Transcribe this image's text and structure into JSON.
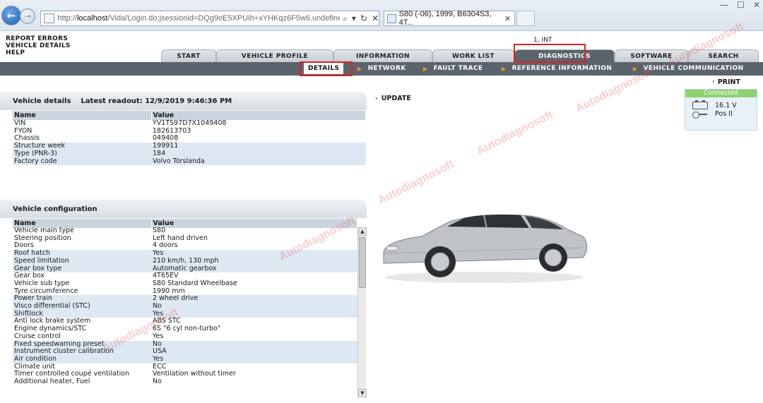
{
  "browser": {
    "url_prefix": "http://",
    "url_host": "localhost",
    "url_rest": "/Vida/Login.do;jsessionid=DQg9oE5XPUih+xYHKqz6F5w6.undefined",
    "address_tools": [
      "⌕",
      "▾",
      "↻",
      "✕"
    ],
    "tab_title": "S80 (-06), 1999, B6304S3, 4T...",
    "tab_close": "✕",
    "window_controls": [
      "—",
      "☐",
      "✕"
    ]
  },
  "toplinks": [
    "REPORT ERRORS",
    "VEHICLE DETAILS",
    "HELP"
  ],
  "user_code": "1, INT",
  "tabs": [
    {
      "label": "START"
    },
    {
      "label": "VEHICLE PROFILE"
    },
    {
      "label": "INFORMATION"
    },
    {
      "label": "WORK LIST"
    },
    {
      "label": "DIAGNOSTICS"
    },
    {
      "label": "SOFTWARE"
    },
    {
      "label": "SEARCH"
    }
  ],
  "subtabs": [
    {
      "label": "DETAILS"
    },
    {
      "label": "NETWORK"
    },
    {
      "label": "FAULT TRACE"
    },
    {
      "label": "REFERENCE INFORMATION"
    },
    {
      "label": "VEHICLE COMMUNICATION"
    }
  ],
  "vehicle_details": {
    "title": "Vehicle details",
    "readout": "Latest readout: 12/9/2019 9:46:36 PM",
    "col_name": "Name",
    "col_value": "Value",
    "rows": [
      [
        "VIN",
        "YV1TS97D7X1049408"
      ],
      [
        "FYON",
        "182613703"
      ],
      [
        "Chassis",
        "049408"
      ],
      [
        "Structure week",
        "199911"
      ],
      [
        "Type (PNR-3)",
        "184"
      ],
      [
        "Factory code",
        "Volvo Torslanda"
      ]
    ]
  },
  "vehicle_config": {
    "title": "Vehicle configuration",
    "col_name": "Name",
    "col_value": "Value",
    "rows": [
      [
        "Vehicle main type",
        "S80"
      ],
      [
        "Steering position",
        "Left hand driven"
      ],
      [
        "Doors",
        "4 doors"
      ],
      [
        "Roof hatch",
        "Yes"
      ],
      [
        "Speed limitation",
        "210 km/h, 130 mph"
      ],
      [
        "Gear box type",
        "Automatic gearbox"
      ],
      [
        "Gear box",
        "4T65EV"
      ],
      [
        "Vehicle sub type",
        "S80 Standard Wheelbase"
      ],
      [
        "Tyre circumference",
        "1990 mm"
      ],
      [
        "Power train",
        "2 wheel drive"
      ],
      [
        "Visco differential (STC)",
        "No"
      ],
      [
        "Shiftlock",
        "Yes"
      ],
      [
        "Anti lock brake system",
        "ABS STC"
      ],
      [
        "Engine dynamics/STC",
        "6S \"6 cyl non-turbo\""
      ],
      [
        "Cruise control",
        "Yes"
      ],
      [
        "Fixed speedwarning preset",
        "No"
      ],
      [
        "Instrument cluster calibration",
        "USA"
      ],
      [
        "Air condition",
        "Yes"
      ],
      [
        "Climate unit",
        "ECC"
      ],
      [
        "Timer controlled coupé ventilation",
        "Ventilation without timer"
      ],
      [
        "Additional heater, Fuel",
        "No"
      ]
    ]
  },
  "actions": {
    "update": "UPDATE",
    "print": "PRINT"
  },
  "connection": {
    "status": "Connected",
    "voltage": "16.1 V",
    "ignition": "Pos II"
  },
  "watermark": "Autodiagnosoft",
  "colors": {
    "subbar": "#5b636c",
    "accent_arrow": "#f39a1c",
    "highlight_box": "#e02020",
    "connected": "#8fd16e",
    "row_alt": "#dde8f3"
  }
}
